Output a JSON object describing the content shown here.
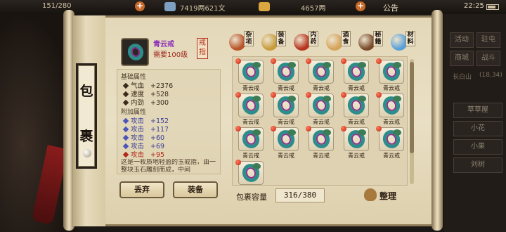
{
  "status_bar": {
    "stamina": "151/280",
    "silver": "7419两621文",
    "gold": "4657两",
    "announcement": "公告",
    "time": "22:25"
  },
  "background": {
    "side_buttons": [
      "活动",
      "驻屯",
      "商城",
      "战斗"
    ],
    "map_label": "长白山",
    "map_coords": "(18,34)",
    "npc_buttons": [
      "草草屋",
      "小花",
      "小果",
      "刘树"
    ]
  },
  "scroll_title": [
    "包",
    "裹"
  ],
  "item_detail": {
    "name": "青云戒",
    "requirement": "需要100级",
    "type_stamp": "戒指",
    "base_header": "基础属性",
    "base_stats": [
      {
        "key": "气血",
        "value": "+2376"
      },
      {
        "key": "速度",
        "value": "+528"
      },
      {
        "key": "内劲",
        "value": "+300"
      }
    ],
    "bonus_header": "附加属性",
    "bonus_stats": [
      {
        "key": "攻击",
        "value": "+152"
      },
      {
        "key": "攻击",
        "value": "+117"
      },
      {
        "key": "攻击",
        "value": "+60"
      },
      {
        "key": "攻击",
        "value": "+69"
      },
      {
        "key": "攻击",
        "value": "+95"
      }
    ],
    "description": "这是一枚质地轻盈的玉戒指，由一整块玉石雕刻而成，中间"
  },
  "buttons": {
    "discard": "丢弃",
    "equip": "装备",
    "sort": "整理"
  },
  "tabs": [
    {
      "label": "杂项",
      "color": "#b9542a"
    },
    {
      "label": "装备",
      "color": "#c89b3c"
    },
    {
      "label": "内药",
      "color": "#b8341e"
    },
    {
      "label": "酒食",
      "color": "#d6a35a"
    },
    {
      "label": "秘籍",
      "color": "#7a4a2a"
    },
    {
      "label": "材料",
      "color": "#5aa0d8"
    }
  ],
  "inventory": {
    "item_name": "青云戒",
    "slot_count": 16,
    "capacity_label": "包裹容量",
    "capacity_value": "316/380"
  }
}
